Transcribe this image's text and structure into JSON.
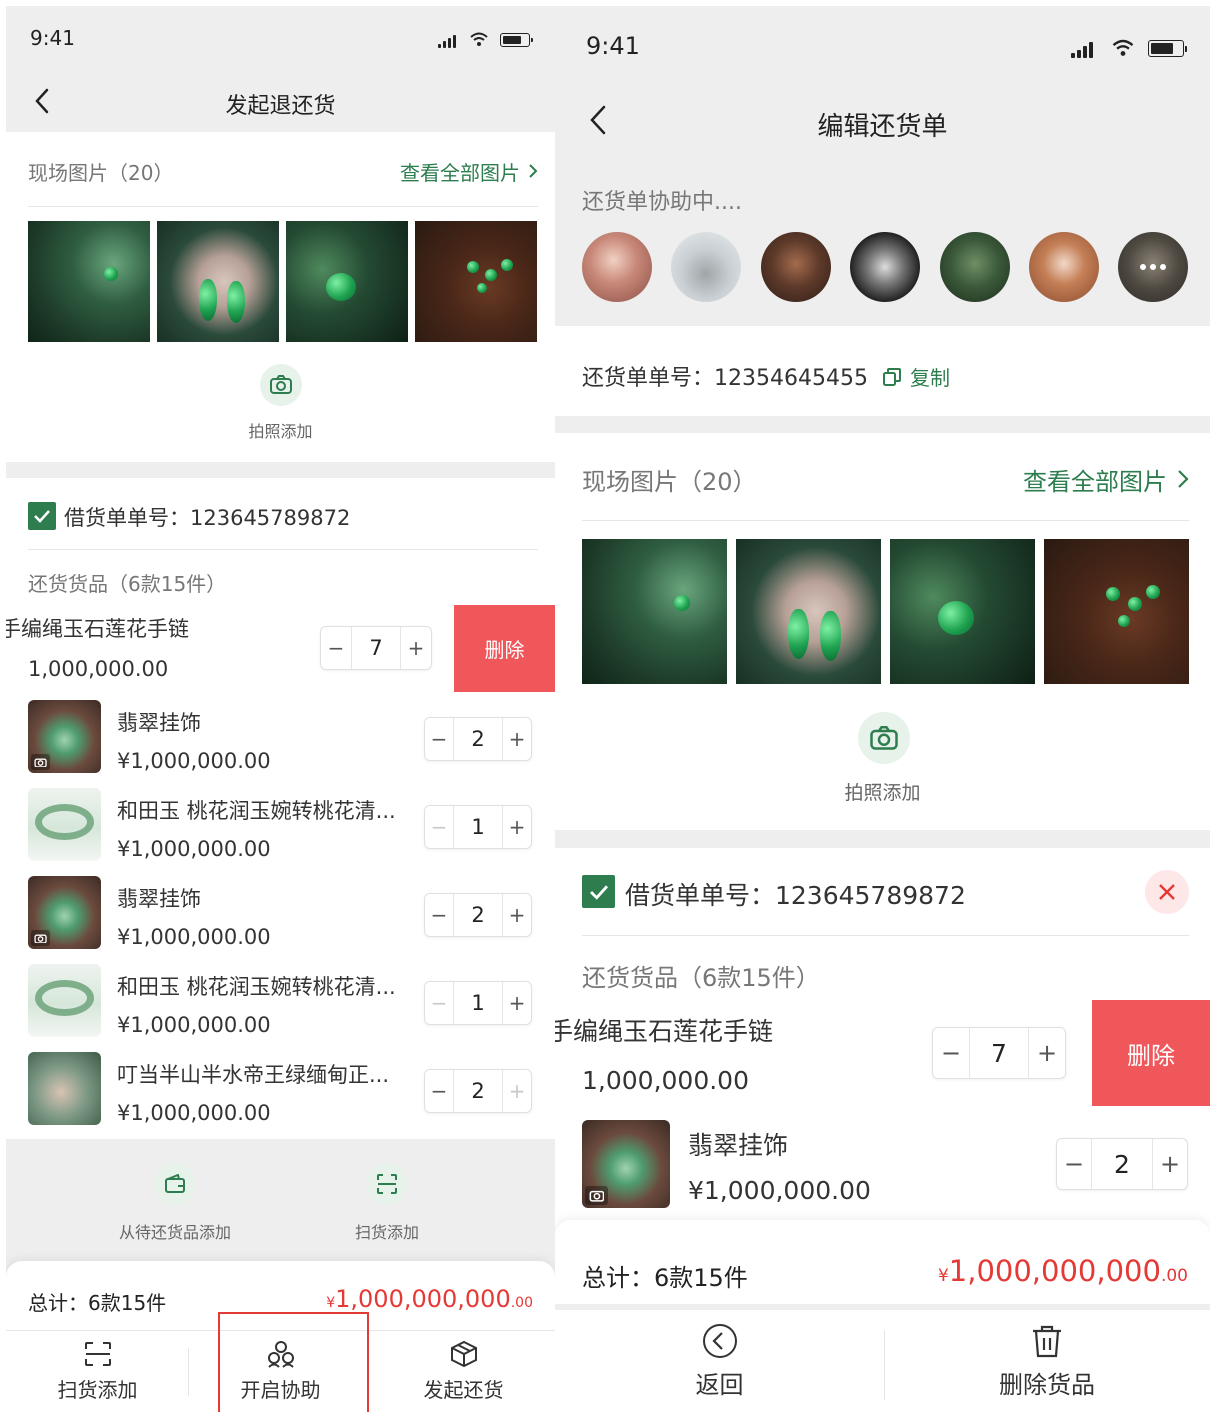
{
  "left": {
    "time": "9:41",
    "title": "发起退还货",
    "photos": {
      "label": "现场图片（20）",
      "view_all": "查看全部图片",
      "add_label": "拍照添加"
    },
    "order": {
      "label": "借货单单号：123645789872"
    },
    "goods_header": "还货货品（6款15件）",
    "delete_label": "删除",
    "swiped_item": {
      "name": "手编绳玉石莲花手链",
      "price": "1,000,000.00",
      "qty": "7"
    },
    "items": [
      {
        "name": "翡翠挂饰",
        "price": "¥1,000,000.00",
        "qty": "2"
      },
      {
        "name": "和田玉 桃花润玉婉转桃花清...",
        "price": "¥1,000,000.00",
        "qty": "1"
      },
      {
        "name": "翡翠挂饰",
        "price": "¥1,000,000.00",
        "qty": "2"
      },
      {
        "name": "和田玉 桃花润玉婉转桃花清...",
        "price": "¥1,000,000.00",
        "qty": "1"
      },
      {
        "name": "叮当半山半水帝王绿缅甸正...",
        "price": "¥1,000,000.00",
        "qty": "2"
      }
    ],
    "add_actions": {
      "from_pending": "从待还货品添加",
      "scan": "扫货添加"
    },
    "total": {
      "label": "总计：6款15件",
      "currency": "¥",
      "amount": "1,000,000,000",
      "decimals": ".00"
    },
    "tabs": {
      "scan": "扫货添加",
      "collab": "开启协助",
      "submit": "发起还货"
    },
    "accent": "#2e7d4f",
    "danger": "#e53935"
  },
  "right": {
    "time": "9:41",
    "title": "编辑还货单",
    "collab_status": "还货单协助中....",
    "return_no": {
      "label": "还货单单号：12354645455",
      "copy": "复制"
    },
    "photos": {
      "label": "现场图片（20）",
      "view_all": "查看全部图片",
      "add_label": "拍照添加"
    },
    "order": {
      "label": "借货单单号：123645789872"
    },
    "goods_header": "还货货品（6款15件）",
    "delete_label": "删除",
    "swiped_item": {
      "name": "手编绳玉石莲花手链",
      "price": "1,000,000.00",
      "qty": "7"
    },
    "items": [
      {
        "name": "翡翠挂饰",
        "price": "¥1,000,000.00",
        "qty": "2"
      }
    ],
    "total": {
      "label": "总计：6款15件",
      "currency": "¥",
      "amount": "1,000,000,000",
      "decimals": ".00"
    },
    "tabs": {
      "back": "返回",
      "delete_goods": "删除货品"
    }
  }
}
